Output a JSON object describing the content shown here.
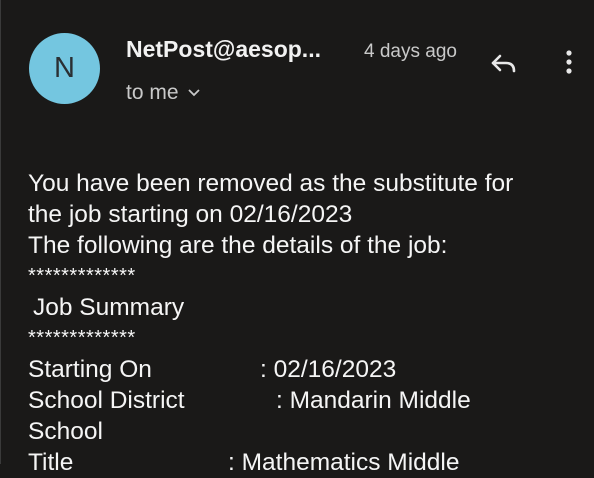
{
  "header": {
    "avatar_letter": "N",
    "avatar_color": "#74c6e0",
    "sender": "NetPost@aesop...",
    "time_ago": "4 days ago",
    "recipient": "to me",
    "recipient_icon": "chevron-down-icon",
    "reply_icon": "reply-icon",
    "more_icon": "more-vert-icon"
  },
  "message": {
    "line1": "You have been removed as the substitute for",
    "line2": "the job starting on 02/16/2023",
    "line3": "The following are the details of the job:",
    "stars1": "*************",
    "summary_title": "Job Summary",
    "stars2": "*************",
    "fields": [
      {
        "label": "Starting On",
        "value": ": 02/16/2023"
      },
      {
        "label": "School District",
        "value": ": Mandarin Middle"
      },
      {
        "label": "School",
        "value": ""
      },
      {
        "label": "Title",
        "value": ": Mathematics Middle"
      }
    ]
  }
}
